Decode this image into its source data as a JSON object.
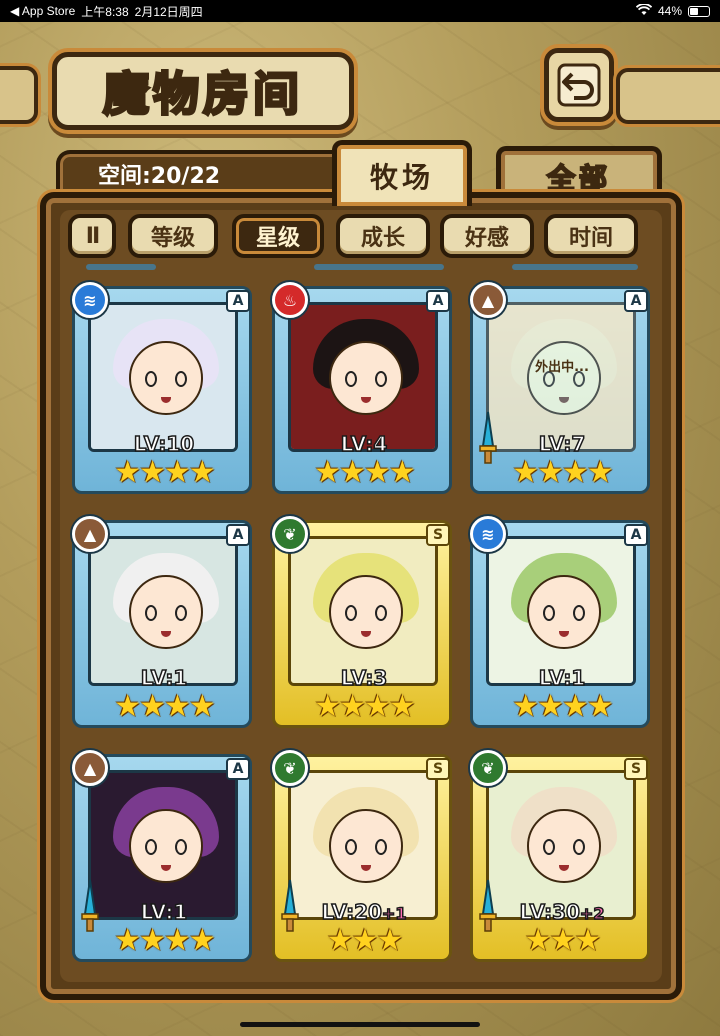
{
  "status_bar": {
    "back_app": "App Store",
    "time": "上午8:38",
    "date": "2月12日周四",
    "battery": "44%",
    "battery_level": 0.44
  },
  "header": {
    "title": "魔物房间",
    "back_icon": "return-arrow-icon"
  },
  "space": {
    "label": "空间:20/22"
  },
  "tabs": [
    {
      "label": "牧场",
      "active": true
    },
    {
      "label": "全部",
      "active": false
    }
  ],
  "filters": [
    {
      "label": "等级",
      "active": false
    },
    {
      "label": "星级",
      "active": true
    },
    {
      "label": "成长",
      "active": false
    },
    {
      "label": "好感",
      "active": false
    },
    {
      "label": "时间",
      "active": false
    }
  ],
  "sort_glyph": "Ⅱ",
  "monsters": [
    {
      "element": "water",
      "rank": "A",
      "level": "LV:10",
      "bonus": "",
      "stars": "★★★★",
      "status": "",
      "has_sword": false,
      "frame": "A",
      "hair": "#e7e3f6",
      "bg": "#d9e7ef"
    },
    {
      "element": "fire",
      "rank": "A",
      "level": "LV:4",
      "bonus": "",
      "stars": "★★★★",
      "status": "",
      "has_sword": false,
      "frame": "A",
      "hair": "#1c1414",
      "bg": "#7a1e1e"
    },
    {
      "element": "earth",
      "rank": "A",
      "level": "LV:7",
      "bonus": "",
      "stars": "★★★★",
      "status": "外出中...",
      "has_sword": true,
      "frame": "A",
      "hair": "#e8dcc0",
      "bg": "#e3d4b4"
    },
    {
      "element": "earth",
      "rank": "A",
      "level": "LV:1",
      "bonus": "",
      "stars": "★★★★",
      "status": "",
      "has_sword": false,
      "frame": "A",
      "hair": "#f0f0f0",
      "bg": "#d7e6e2"
    },
    {
      "element": "wood",
      "rank": "S",
      "level": "LV:3",
      "bonus": "",
      "stars": "★★★★",
      "status": "",
      "has_sword": false,
      "frame": "S",
      "hair": "#e6e27a",
      "bg": "#f1ecc0"
    },
    {
      "element": "water",
      "rank": "A",
      "level": "LV:1",
      "bonus": "",
      "stars": "★★★★",
      "status": "",
      "has_sword": false,
      "frame": "A",
      "hair": "#a8cf7a",
      "bg": "#edf4e4"
    },
    {
      "element": "earth",
      "rank": "A",
      "level": "LV:1",
      "bonus": "",
      "stars": "★★★★",
      "status": "",
      "has_sword": true,
      "frame": "A",
      "hair": "#7a3a8e",
      "bg": "#2a1a30"
    },
    {
      "element": "wood",
      "rank": "S",
      "level": "LV:20",
      "bonus": "+1",
      "stars": "★★★",
      "status": "",
      "has_sword": true,
      "frame": "S",
      "hair": "#f2e2b0",
      "bg": "#f7efd2"
    },
    {
      "element": "wood",
      "rank": "S",
      "level": "LV:30",
      "bonus": "+2",
      "stars": "★★★",
      "status": "",
      "has_sword": true,
      "frame": "S",
      "hair": "#efe0c8",
      "bg": "#e8efd0"
    }
  ],
  "colors": {
    "element_water": "#2a7bd8",
    "element_fire": "#d42a2a",
    "element_earth": "#8a5a38",
    "element_wood": "#2f7a2f",
    "bonus": "#ff6fb5",
    "star": "#ffd21f"
  }
}
